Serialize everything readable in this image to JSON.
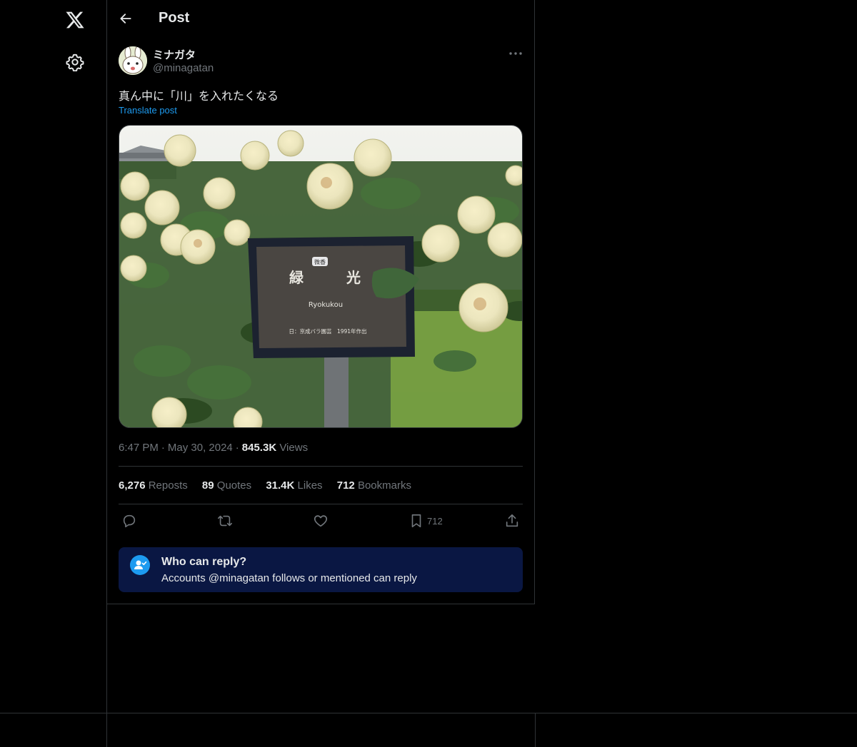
{
  "header": {
    "title": "Post"
  },
  "author": {
    "display_name": "ミナガタ",
    "handle": "@minagatan"
  },
  "post": {
    "text": "真ん中に「川」を入れたくなる",
    "translate_label": "Translate post",
    "image": {
      "sign_badge": "微香",
      "sign_title_left": "緑",
      "sign_title_right": "光",
      "sign_subtitle": "Ryokukou",
      "sign_footer": "日：京成バラ園芸　1991年作出"
    }
  },
  "meta": {
    "time": "6:47 PM",
    "date": "May 30, 2024",
    "views_count": "845.3K",
    "views_label": "Views"
  },
  "stats": {
    "reposts_count": "6,276",
    "reposts_label": "Reposts",
    "quotes_count": "89",
    "quotes_label": "Quotes",
    "likes_count": "31.4K",
    "likes_label": "Likes",
    "bookmarks_count": "712",
    "bookmarks_label": "Bookmarks"
  },
  "actions": {
    "reply_icon": "reply-icon",
    "repost_icon": "repost-icon",
    "like_icon": "heart-icon",
    "bookmark_icon": "bookmark-icon",
    "bookmark_count": "712",
    "share_icon": "share-icon"
  },
  "reply_settings": {
    "title": "Who can reply?",
    "description": "Accounts @minagatan follows or mentioned can reply"
  },
  "colors": {
    "accent": "#1d9bf0",
    "background": "#000000",
    "muted": "#71767b",
    "reply_box_bg": "#0a1743"
  }
}
